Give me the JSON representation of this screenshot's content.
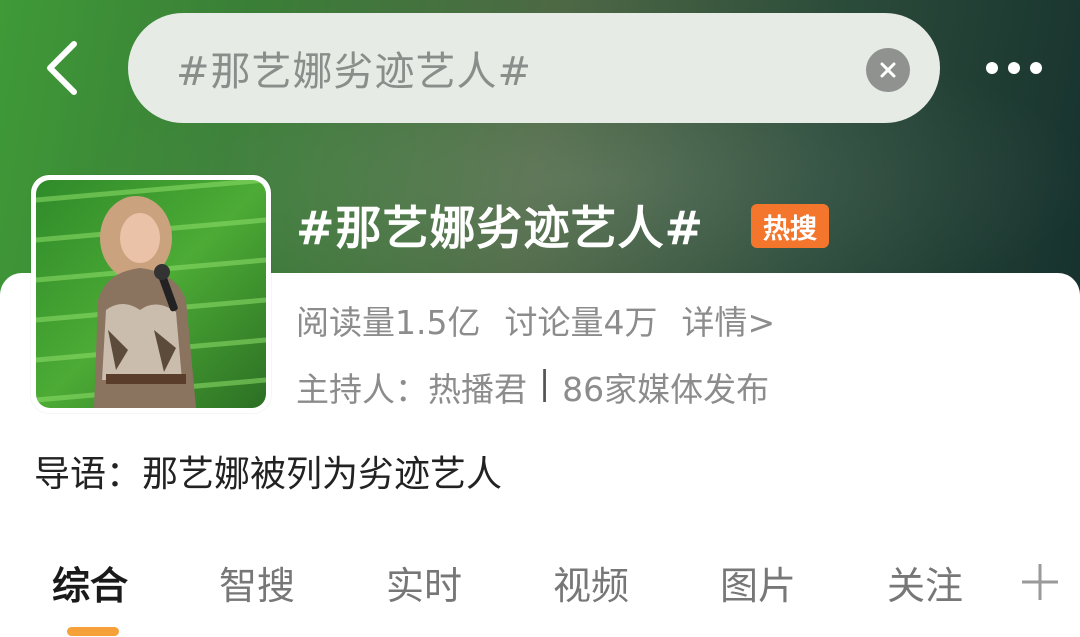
{
  "search": {
    "query": "#那艺娜劣迹艺人#"
  },
  "topic": {
    "title": "#那艺娜劣迹艺人#",
    "badge": "热搜",
    "reads": "阅读量1.5亿",
    "discussions": "讨论量4万",
    "detail_link": "详情>",
    "host": "主持人：热播君",
    "separator": "|",
    "media": "86家媒体发布",
    "intro": "导语：那艺娜被列为劣迹艺人"
  },
  "tabs": [
    {
      "label": "综合",
      "active": true
    },
    {
      "label": "智搜",
      "active": false
    },
    {
      "label": "实时",
      "active": false
    },
    {
      "label": "视频",
      "active": false
    },
    {
      "label": "图片",
      "active": false
    },
    {
      "label": "关注",
      "active": false
    }
  ],
  "icons": {
    "back": "chevron-left-icon",
    "clear": "close-icon",
    "more": "more-dots-icon",
    "add_tab": "plus-icon"
  },
  "colors": {
    "badge": "#f4762c",
    "tab_indicator": "#f6a03a",
    "header_start": "#3f9a37",
    "header_end": "#17322e"
  }
}
